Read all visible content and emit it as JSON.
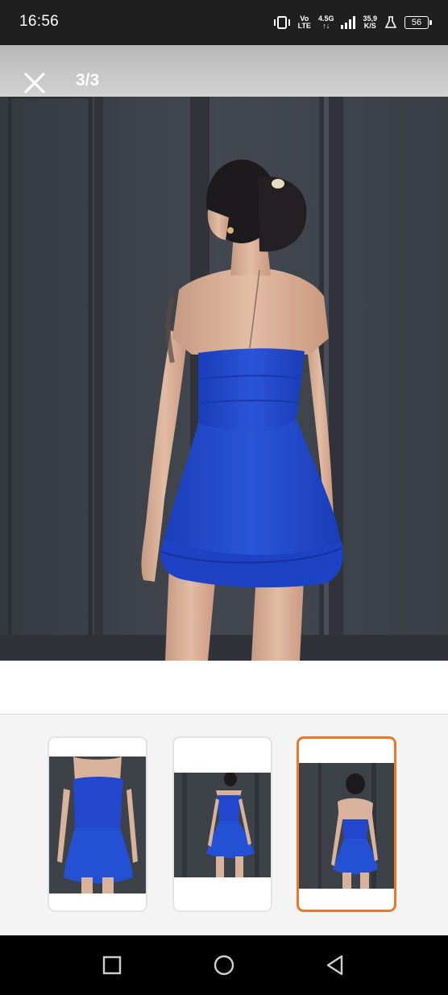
{
  "status_bar": {
    "time": "16:56",
    "network_top": "Vo",
    "network_bottom": "LTE",
    "gen_top": "4.5G",
    "gen_bottom": "↑↓",
    "speed_top": "35,9",
    "speed_bottom": "K/S",
    "battery": "56"
  },
  "viewer": {
    "counter": "3/3",
    "current_index": 3,
    "total": 3
  },
  "thumbnails": [
    {
      "name": "thumbnail-1",
      "selected": false
    },
    {
      "name": "thumbnail-2",
      "selected": false
    },
    {
      "name": "thumbnail-3",
      "selected": true
    }
  ],
  "colors": {
    "dress": "#1f45c9",
    "wall": "#3d4249",
    "selected_border": "#e8782a"
  }
}
